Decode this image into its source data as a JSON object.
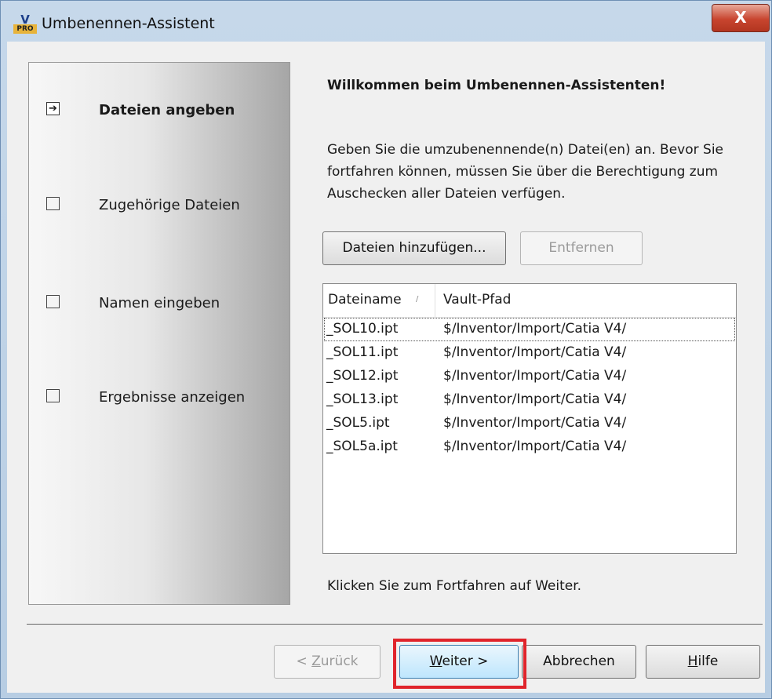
{
  "window": {
    "title": "Umbenennen-Assistent",
    "app_icon": {
      "top": "V",
      "bottom": "PRO"
    },
    "close_label": "X"
  },
  "steps": [
    {
      "label": "Dateien angeben",
      "state": "current",
      "icon": "arrow-right-icon"
    },
    {
      "label": "Zugehörige Dateien",
      "state": "pending",
      "icon": "checkbox-icon"
    },
    {
      "label": "Namen eingeben",
      "state": "pending",
      "icon": "checkbox-icon"
    },
    {
      "label": "Ergebnisse anzeigen",
      "state": "pending",
      "icon": "checkbox-icon"
    }
  ],
  "content": {
    "heading": "Willkommen beim Umbenennen-Assistenten!",
    "description": "Geben Sie die umzubenennende(n) Datei(en) an. Bevor Sie fortfahren können, müssen Sie über die Berechtigung zum Auschecken aller Dateien verfügen.",
    "add_button": "Dateien hinzufügen...",
    "remove_button": "Entfernen",
    "hint": "Klicken Sie zum Fortfahren auf Weiter."
  },
  "file_list": {
    "columns": [
      "Dateiname",
      "Vault-Pfad"
    ],
    "rows": [
      {
        "name": "_SOL10.ipt",
        "path": "$/Inventor/Import/Catia V4/"
      },
      {
        "name": "_SOL11.ipt",
        "path": "$/Inventor/Import/Catia V4/"
      },
      {
        "name": "_SOL12.ipt",
        "path": "$/Inventor/Import/Catia V4/"
      },
      {
        "name": "_SOL13.ipt",
        "path": "$/Inventor/Import/Catia V4/"
      },
      {
        "name": "_SOL5.ipt",
        "path": "$/Inventor/Import/Catia V4/"
      },
      {
        "name": "_SOL5a.ipt",
        "path": "$/Inventor/Import/Catia V4/"
      }
    ]
  },
  "footer": {
    "back": {
      "pre": "< ",
      "mnemonic": "Z",
      "post": "urück"
    },
    "next": {
      "pre": "",
      "mnemonic": "W",
      "post": "eiter >"
    },
    "cancel": "Abbrechen",
    "help": {
      "pre": "",
      "mnemonic": "H",
      "post": "ilfe"
    }
  },
  "colors": {
    "highlight_border": "#e0242b",
    "close_button": "#c8452f"
  }
}
